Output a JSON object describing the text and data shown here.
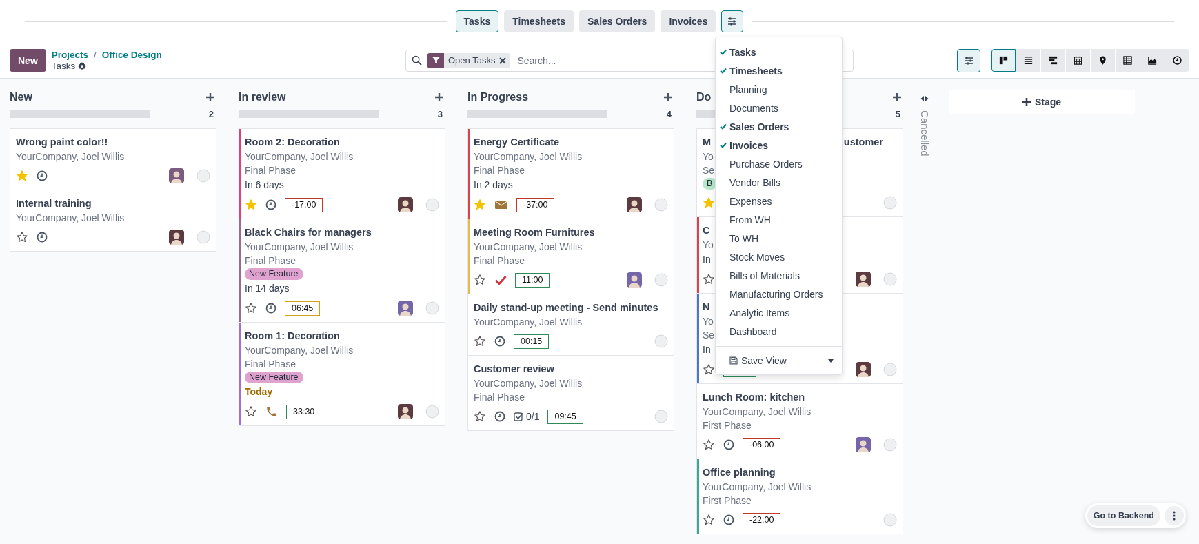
{
  "top_tabs": [
    {
      "label": "Tasks",
      "selected": true
    },
    {
      "label": "Timesheets",
      "selected": false
    },
    {
      "label": "Sales Orders",
      "selected": false
    },
    {
      "label": "Invoices",
      "selected": false
    }
  ],
  "top_settings_button": {
    "open": true
  },
  "new_button": "New",
  "breadcrumb": {
    "path": [
      "Projects",
      "Office Design"
    ],
    "separator": "/",
    "current": "Tasks"
  },
  "search": {
    "facet": "Open Tasks",
    "placeholder": "Search..."
  },
  "filter_toggle": {
    "selected": true
  },
  "views": [
    {
      "kind": "kanban",
      "selected": true
    },
    {
      "kind": "list",
      "selected": false
    },
    {
      "kind": "gantt",
      "selected": false
    },
    {
      "kind": "calendar",
      "selected": false
    },
    {
      "kind": "map",
      "selected": false
    },
    {
      "kind": "pivot",
      "selected": false
    },
    {
      "kind": "graph",
      "selected": false
    },
    {
      "kind": "activity",
      "selected": false
    }
  ],
  "columns": [
    {
      "title": "New",
      "count": "2",
      "progress": {
        "level": 0
      },
      "cards": [
        {
          "title": [
            "Wrong paint color!!"
          ],
          "company": "YourCompany, Joel Willis",
          "starred": true,
          "activity": {
            "kind": "clock"
          },
          "avatar": {
            "color": "#7a5c7e"
          }
        },
        {
          "title": [
            "Internal training"
          ],
          "company": "YourCompany, Joel Willis",
          "starred": false,
          "activity": {
            "kind": "clock"
          },
          "avatar": {
            "color": "#5b3b3f"
          }
        }
      ]
    },
    {
      "title": "In review",
      "count": "3",
      "progress": {
        "level": 0
      },
      "cards": [
        {
          "color": "#e0407e",
          "title": [
            "Room 2: Decoration"
          ],
          "company": "YourCompany, Joel Willis",
          "phase": "Final Phase",
          "deadline": "In 6 days",
          "today": false,
          "starred": true,
          "activity": {
            "kind": "clock"
          },
          "time": {
            "text": "-17:00",
            "color": "#c0392b"
          },
          "avatar": {
            "color": "#5b3b3f"
          }
        },
        {
          "color": "#9a6b8f",
          "title": [
            "Black Chairs for managers"
          ],
          "company": "YourCompany, Joel Willis",
          "phase": "Final Phase",
          "tags": [
            {
              "label": "New Feature",
              "color": "#e0a3cf"
            }
          ],
          "deadline": "In 14 days",
          "today": false,
          "starred": false,
          "activity": {
            "kind": "clock"
          },
          "time": {
            "text": "06:45",
            "color": "#d4a017"
          },
          "avatar": {
            "color": "#7466a8"
          }
        },
        {
          "color": "#a26fd6",
          "title": [
            "Room 1: Decoration"
          ],
          "company": "YourCompany, Joel Willis",
          "phase": "Final Phase",
          "tags": [
            {
              "label": "New Feature",
              "color": "#e0a3cf"
            }
          ],
          "deadline": "Today",
          "today": true,
          "starred": false,
          "activity": {
            "kind": "call"
          },
          "time": {
            "text": "33:30",
            "color": "#2e8b57"
          },
          "avatar": {
            "color": "#5b3b3f"
          }
        }
      ]
    },
    {
      "title": "In Progress",
      "count": "4",
      "progress": {
        "level": 0
      },
      "cards": [
        {
          "color": "#d9434f",
          "title": [
            "Energy Certificate"
          ],
          "company": "YourCompany, Joel Willis",
          "phase": "Final Phase",
          "deadline": "In 2 days",
          "today": false,
          "starred": true,
          "activity": {
            "kind": "email"
          },
          "time": {
            "text": "-37:00",
            "color": "#c0392b"
          },
          "avatar": {
            "color": "#5b3b3f"
          }
        },
        {
          "color": "#e6b94a",
          "title": [
            "Meeting Room Furnitures"
          ],
          "company": "YourCompany, Joel Willis",
          "phase": "Final Phase",
          "starred": false,
          "activity": {
            "kind": "done"
          },
          "time": {
            "text": "11:00",
            "color": "#2e8b57"
          },
          "avatar": {
            "color": "#7466a8"
          }
        },
        {
          "title": [
            "Daily stand-up meeting - Send minutes"
          ],
          "company": "YourCompany, Joel Willis",
          "starred": false,
          "activity": {
            "kind": "clock"
          },
          "time": {
            "text": "00:15",
            "color": "#2e8b57"
          }
        },
        {
          "title": [
            "Customer review"
          ],
          "company": "YourCompany, Joel Willis",
          "phase": "Final Phase",
          "starred": false,
          "activity": {
            "kind": "clock"
          },
          "checklist": "0/1",
          "time": {
            "text": "09:45",
            "color": "#2e8b57"
          }
        }
      ]
    },
    {
      "title": "Do",
      "count": "5",
      "progress": {
        "level": 0
      },
      "cards": [
        {
          "title": [
            "M",
            "ustomer"
          ],
          "company": "Yo",
          "phase": "Se",
          "tags": [
            {
              "label": "B",
              "color": "#b8e6c8"
            }
          ],
          "starred": true
        },
        {
          "color": "#d9434f",
          "title": [
            "C"
          ],
          "company": "Yo",
          "deadline": "In",
          "today": false,
          "starred": false,
          "avatar": {
            "color": "#5b3b3f"
          }
        },
        {
          "color": "#4a78c4",
          "title": [
            "N"
          ],
          "company": "Yo",
          "phase": "Se",
          "deadline": "In",
          "today": false,
          "starred": false,
          "time": {
            "color": "#2e8b57"
          },
          "avatar": {
            "color": "#5b3b3f"
          }
        },
        {
          "title": [
            "Lunch Room: kitchen"
          ],
          "company": "YourCompany, Joel Willis",
          "phase": "First Phase",
          "starred": false,
          "activity": {
            "kind": "clock"
          },
          "time": {
            "text": "-06:00",
            "color": "#c0392b"
          },
          "avatar": {
            "color": "#7466a8"
          }
        },
        {
          "color": "#3aa893",
          "title": [
            "Office planning"
          ],
          "company": "YourCompany, Joel Willis",
          "phase": "First Phase",
          "starred": false,
          "activity": {
            "kind": "clock"
          },
          "time": {
            "text": "-22:00",
            "color": "#c0392b"
          }
        }
      ]
    }
  ],
  "folded_column": {
    "title": "Cancelled"
  },
  "add_stage": "Stage",
  "dropdown": {
    "items": [
      {
        "label": "Tasks",
        "checked": true
      },
      {
        "label": "Timesheets",
        "checked": true
      },
      {
        "label": "Planning",
        "checked": false
      },
      {
        "label": "Documents",
        "checked": false
      },
      {
        "label": "Sales Orders",
        "checked": true
      },
      {
        "label": "Invoices",
        "checked": true
      },
      {
        "label": "Purchase Orders",
        "checked": false
      },
      {
        "label": "Vendor Bills",
        "checked": false
      },
      {
        "label": "Expenses",
        "checked": false
      },
      {
        "label": "From WH",
        "checked": false
      },
      {
        "label": "To WH",
        "checked": false
      },
      {
        "label": "Stock Moves",
        "checked": false
      },
      {
        "label": "Bills of Materials",
        "checked": false
      },
      {
        "label": "Manufacturing Orders",
        "checked": false
      },
      {
        "label": "Analytic Items",
        "checked": false
      },
      {
        "label": "Dashboard",
        "checked": false
      }
    ],
    "save_view": "Save View"
  },
  "backend_button": "Go to Backend"
}
